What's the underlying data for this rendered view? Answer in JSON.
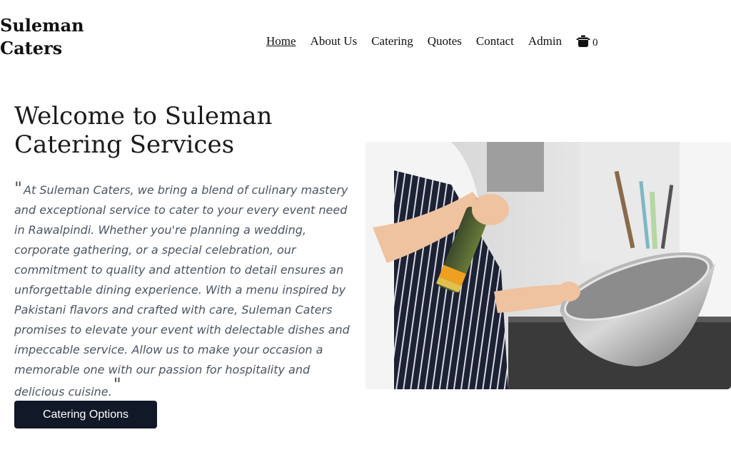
{
  "brand": {
    "line1": "Suleman",
    "line2": "Caters"
  },
  "nav": {
    "items": [
      {
        "label": "Home",
        "active": true
      },
      {
        "label": "About Us"
      },
      {
        "label": "Catering"
      },
      {
        "label": "Quotes"
      },
      {
        "label": "Contact"
      },
      {
        "label": "Admin"
      }
    ],
    "cart": {
      "icon": "cooking-pot-icon",
      "count": "0"
    }
  },
  "hero": {
    "title": "Welcome to Suleman Catering Services",
    "open_quote": "\"",
    "close_quote": "\"",
    "quote": "At Suleman Caters, we bring a blend of culinary mastery and exceptional service to cater to your every event need in Rawalpindi. Whether you're planning a wedding, corporate gathering, or a special celebration, our commitment to quality and attention to detail ensures an unforgettable dining experience. With a menu inspired by Pakistani flavors and crafted with care, Suleman Caters promises to elevate your event with delectable dishes and impeccable service. Allow us to make your occasion a memorable one with our passion for hospitality and delicious cuisine.",
    "cta_label": "Catering Options"
  },
  "colors": {
    "primary_dark": "#111827",
    "body_text": "#4b5563"
  }
}
